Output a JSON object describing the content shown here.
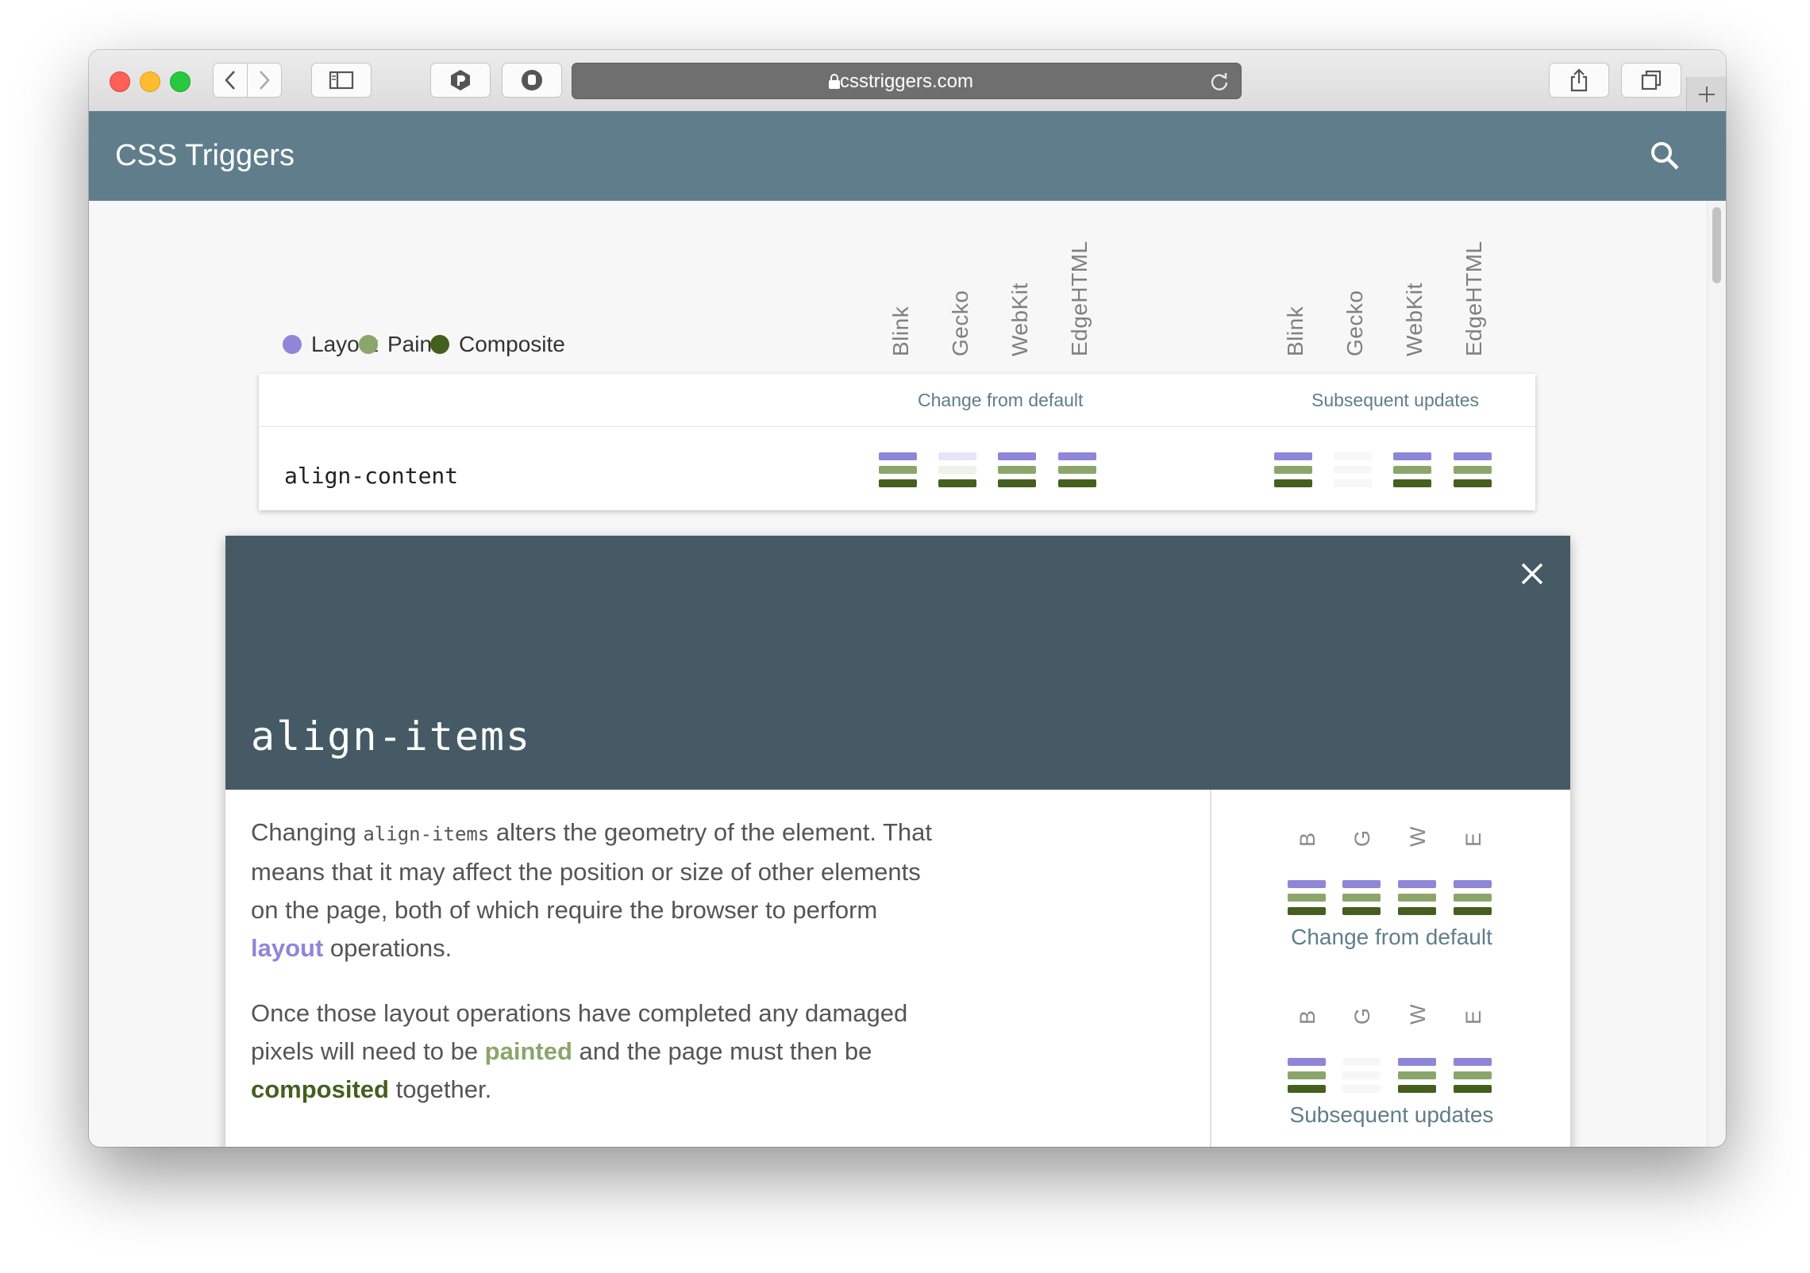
{
  "browser": {
    "url": "csstriggers.com"
  },
  "app": {
    "title": "CSS Triggers"
  },
  "legend": [
    {
      "label": "Layout",
      "color": "#8f86d9"
    },
    {
      "label": "Paint",
      "color": "#8ba66b"
    },
    {
      "label": "Composite",
      "color": "#455f1e"
    }
  ],
  "engines": [
    "Blink",
    "Gecko",
    "WebKit",
    "EdgeHTML"
  ],
  "table": {
    "groups": [
      "Change from default",
      "Subsequent updates"
    ],
    "rows": [
      {
        "property": "align-content",
        "change_from_default": [
          {
            "layout": true,
            "paint": true,
            "composite": true
          },
          {
            "layout": false,
            "paint": false,
            "composite": true
          },
          {
            "layout": true,
            "paint": true,
            "composite": true
          },
          {
            "layout": true,
            "paint": true,
            "composite": true
          }
        ],
        "subsequent_updates": [
          {
            "layout": true,
            "paint": true,
            "composite": true
          },
          null,
          {
            "layout": true,
            "paint": true,
            "composite": true
          },
          {
            "layout": true,
            "paint": true,
            "composite": true
          }
        ]
      }
    ]
  },
  "detail": {
    "title": "align-items",
    "p1_a": "Changing ",
    "p1_code": "align-items",
    "p1_b": " alters the geometry of the element. That means that it may affect the position or size of other elements on the page, both of which require the browser to perform ",
    "p1_kw": "layout",
    "p1_c": " operations.",
    "p2_a": "Once those layout operations have completed any damaged pixels will need to be ",
    "p2_kw1": "painted",
    "p2_b": " and the page must then be ",
    "p2_kw2": "composited",
    "p2_c": " together.",
    "engine_letters": [
      "B",
      "G",
      "W",
      "E"
    ],
    "change_caption": "Change from default",
    "subsequent_caption": "Subsequent updates",
    "change_from_default": [
      {
        "layout": true,
        "paint": true,
        "composite": true
      },
      {
        "layout": true,
        "paint": true,
        "composite": true
      },
      {
        "layout": true,
        "paint": true,
        "composite": true
      },
      {
        "layout": true,
        "paint": true,
        "composite": true
      }
    ],
    "subsequent_updates": [
      {
        "layout": true,
        "paint": true,
        "composite": true
      },
      null,
      {
        "layout": true,
        "paint": true,
        "composite": true
      },
      {
        "layout": true,
        "paint": true,
        "composite": true
      }
    ]
  }
}
